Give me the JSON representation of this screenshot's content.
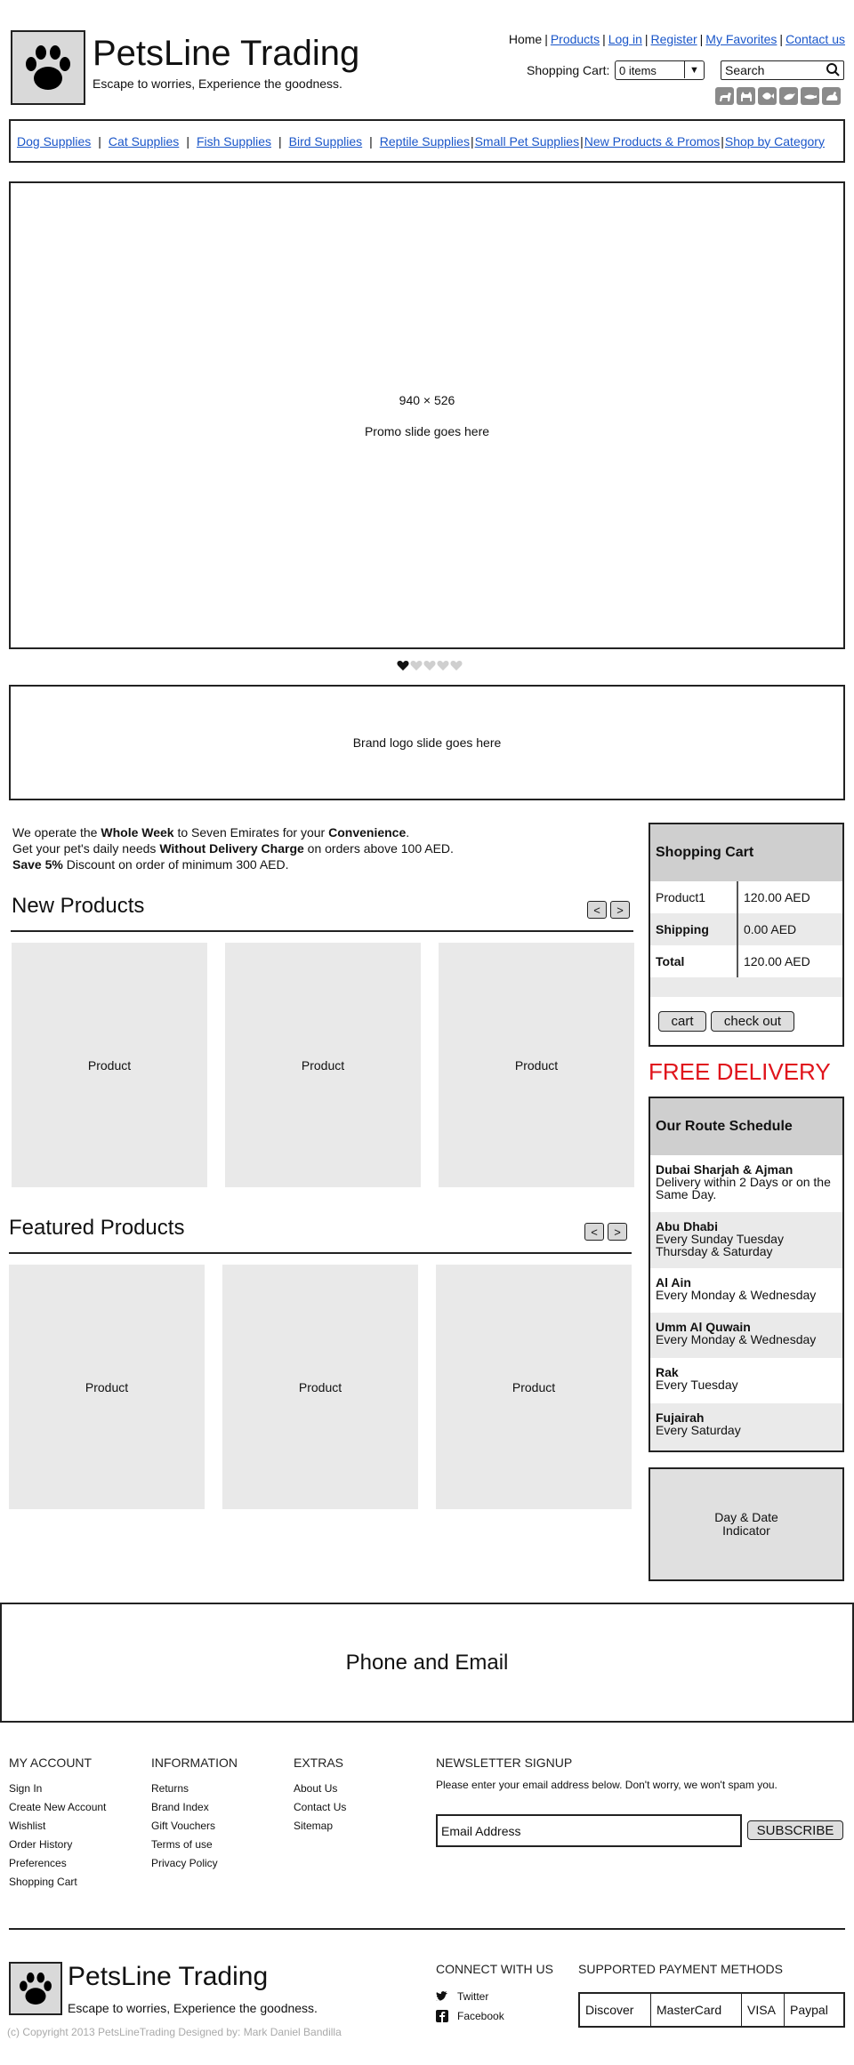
{
  "header": {
    "site_title": "PetsLine Trading",
    "tagline": "Escape to worries, Experience the goodness."
  },
  "top_nav": {
    "home": "Home",
    "products": "Products",
    "login": "Log in",
    "register": "Register",
    "favorites": "My Favorites",
    "contact": "Contact us"
  },
  "cart_bar": {
    "label": "Shopping Cart:",
    "value": "0 items",
    "search_placeholder": "Search"
  },
  "pet_icons": [
    "dog-icon",
    "cat-icon",
    "fish-icon",
    "bird-icon",
    "reptile-icon",
    "small-pet-icon"
  ],
  "categories": {
    "dog": "Dog Supplies",
    "cat": "Cat Supplies",
    "fish": "Fish Supplies",
    "bird": "Bird Supplies",
    "reptile": "Reptile Supplies",
    "small_pet": "Small Pet Supplies",
    "new": "New Products & Promos",
    "shop_by": "Shop by Category"
  },
  "promo": {
    "dimensions": "940 × 526",
    "text": "Promo slide goes here",
    "active_dot": 1,
    "dot_count": 5
  },
  "brand_slide": {
    "text": "Brand logo slide goes here"
  },
  "intro": {
    "l1_a": "We operate the ",
    "l1_b": "Whole Week",
    "l1_c": " to Seven Emirates for your ",
    "l1_d": "Convenience",
    "l1_e": ".",
    "l2_a": "Get your pet's daily needs ",
    "l2_b": "Without Delivery Charge",
    "l2_c": " on orders above 100 AED.",
    "l3_a": "Save",
    "l3_b": " 5%",
    "l3_c": " Discount on order of minimum 300 AED."
  },
  "new_products": {
    "title": "New Products",
    "prev": "<",
    "next": ">",
    "items": [
      "Product",
      "Product",
      "Product"
    ]
  },
  "featured_products": {
    "title": "Featured Products",
    "prev": "<",
    "next": ">",
    "items": [
      "Product",
      "Product",
      "Product"
    ]
  },
  "sidebar_cart": {
    "title": "Shopping Cart",
    "rows": [
      {
        "label": "Product1",
        "value": "120.00 AED"
      },
      {
        "label": "Shipping",
        "value": "0.00 AED"
      },
      {
        "label": "Total",
        "value": "120.00 AED"
      }
    ],
    "cart_btn": "cart",
    "checkout_btn": "check out"
  },
  "free_delivery": "FREE DELIVERY",
  "route_schedule": {
    "title": "Our Route Schedule",
    "items": [
      {
        "place": "Dubai Sharjah & Ajman",
        "schedule": "Delivery within 2 Days or on the Same Day."
      },
      {
        "place": "Abu Dhabi",
        "schedule": "Every Sunday Tuesday Thursday & Saturday"
      },
      {
        "place": "Al Ain",
        "schedule": "Every Monday & Wednesday"
      },
      {
        "place": "Umm Al Quwain",
        "schedule": "Every Monday & Wednesday"
      },
      {
        "place": "Rak",
        "schedule": "Every Tuesday"
      },
      {
        "place": "Fujairah",
        "schedule": "Every Saturday"
      }
    ]
  },
  "day_date": {
    "l1": "Day & Date",
    "l2": "Indicator"
  },
  "phone_email": "Phone and Email",
  "footer": {
    "my_account": {
      "title": "MY ACCOUNT",
      "items": [
        "Sign In",
        "Create New Account",
        "Wishlist",
        "Order History",
        "Preferences",
        "Shopping Cart"
      ]
    },
    "information": {
      "title": "INFORMATION",
      "items": [
        "Returns",
        "Brand Index",
        "Gift Vouchers",
        "Terms of use",
        "Privacy Policy"
      ]
    },
    "extras": {
      "title": "EXTRAS",
      "items": [
        "About Us",
        "Contact Us",
        "Sitemap"
      ]
    },
    "newsletter": {
      "title": "NEWSLETTER SIGNUP",
      "note": "Please enter your email address below. Don't worry, we won't spam you.",
      "placeholder": "Email Address",
      "button": "SUBSCRIBE"
    },
    "connect": {
      "title": "CONNECT WITH US",
      "twitter": "Twitter",
      "facebook": "Facebook"
    },
    "payments": {
      "title": "SUPPORTED PAYMENT METHODS",
      "methods": [
        "Discover",
        "MasterCard",
        "VISA",
        "Paypal"
      ]
    },
    "site_title": "PetsLine Trading",
    "tagline": "Escape to worries, Experience the goodness.",
    "copyright": "(c) Copyright 2013 PetsLineTrading Designed by: Mark Daniel Bandilla"
  },
  "colors": {
    "link": "#1a56c9",
    "free_delivery": "#e0141c",
    "panel_head": "#cfcfcf",
    "product_bg": "#e9e9e9"
  }
}
